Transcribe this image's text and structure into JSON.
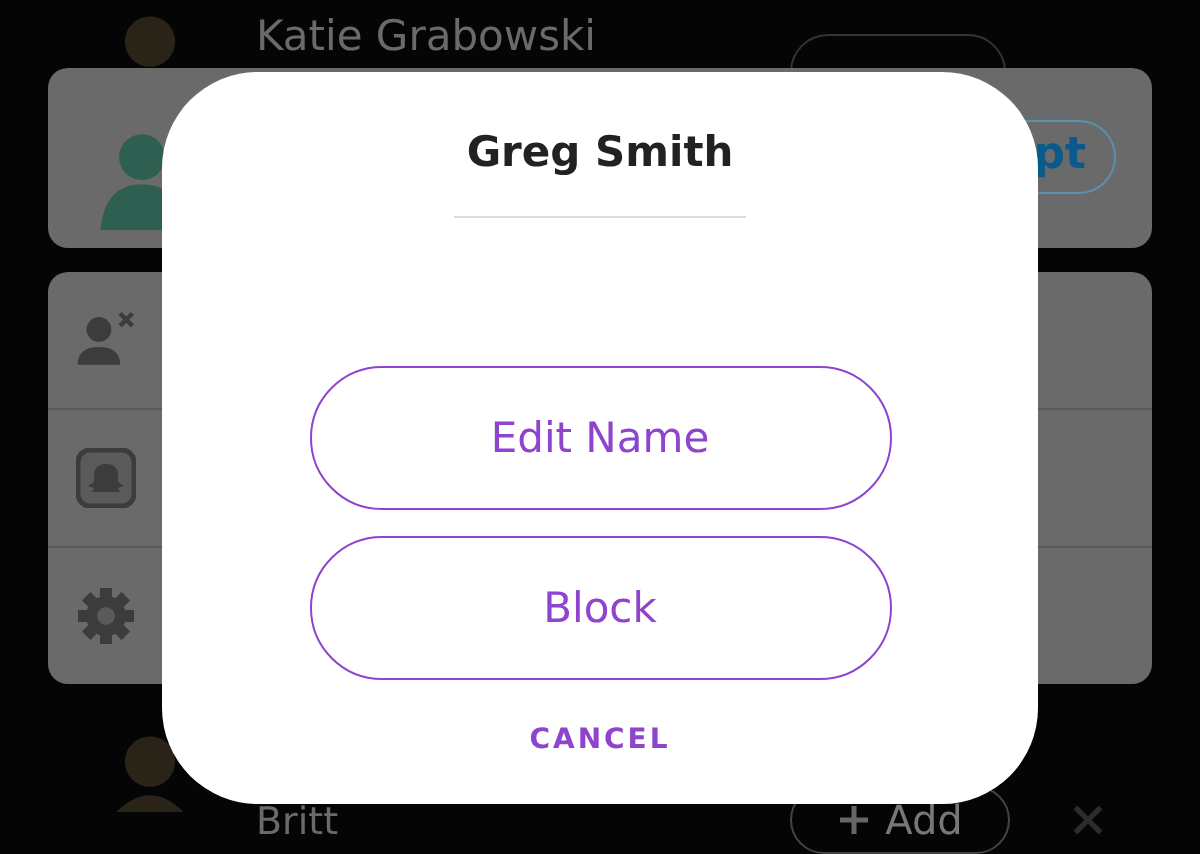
{
  "background": {
    "top_row": {
      "name": "Katie Grabowski"
    },
    "request_card": {
      "action": "pt"
    },
    "menu_card": {
      "items": [
        {
          "kind": "remove-friend"
        },
        {
          "kind": "snapcode"
        },
        {
          "kind": "settings"
        }
      ]
    },
    "bottom_row": {
      "name": "Britt",
      "action": "Add"
    }
  },
  "dialog": {
    "title": "Greg Smith",
    "buttons": [
      "Edit Name",
      "Block"
    ],
    "cancel": "CANCEL"
  }
}
